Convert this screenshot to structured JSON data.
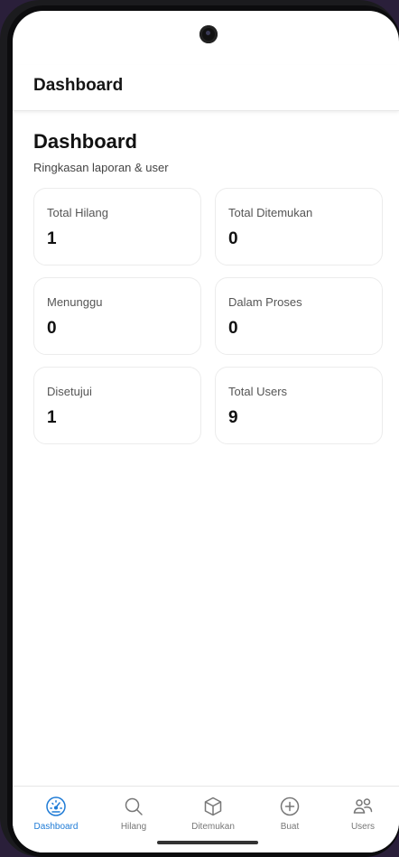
{
  "appbar": {
    "title": "Dashboard"
  },
  "page": {
    "title": "Dashboard",
    "subtitle": "Ringkasan laporan & user"
  },
  "cards": [
    {
      "label": "Total Hilang",
      "value": "1"
    },
    {
      "label": "Total Ditemukan",
      "value": "0"
    },
    {
      "label": "Menunggu",
      "value": "0"
    },
    {
      "label": "Dalam Proses",
      "value": "0"
    },
    {
      "label": "Disetujui",
      "value": "1"
    },
    {
      "label": "Total Users",
      "value": "9"
    }
  ],
  "nav": {
    "active": "Dashboard",
    "accent_color": "#1e7bd6",
    "items": [
      {
        "label": "Dashboard",
        "icon": "speedometer-icon"
      },
      {
        "label": "Hilang",
        "icon": "search-icon"
      },
      {
        "label": "Ditemukan",
        "icon": "cube-icon"
      },
      {
        "label": "Buat",
        "icon": "plus-circle-icon"
      },
      {
        "label": "Users",
        "icon": "users-icon"
      }
    ]
  }
}
